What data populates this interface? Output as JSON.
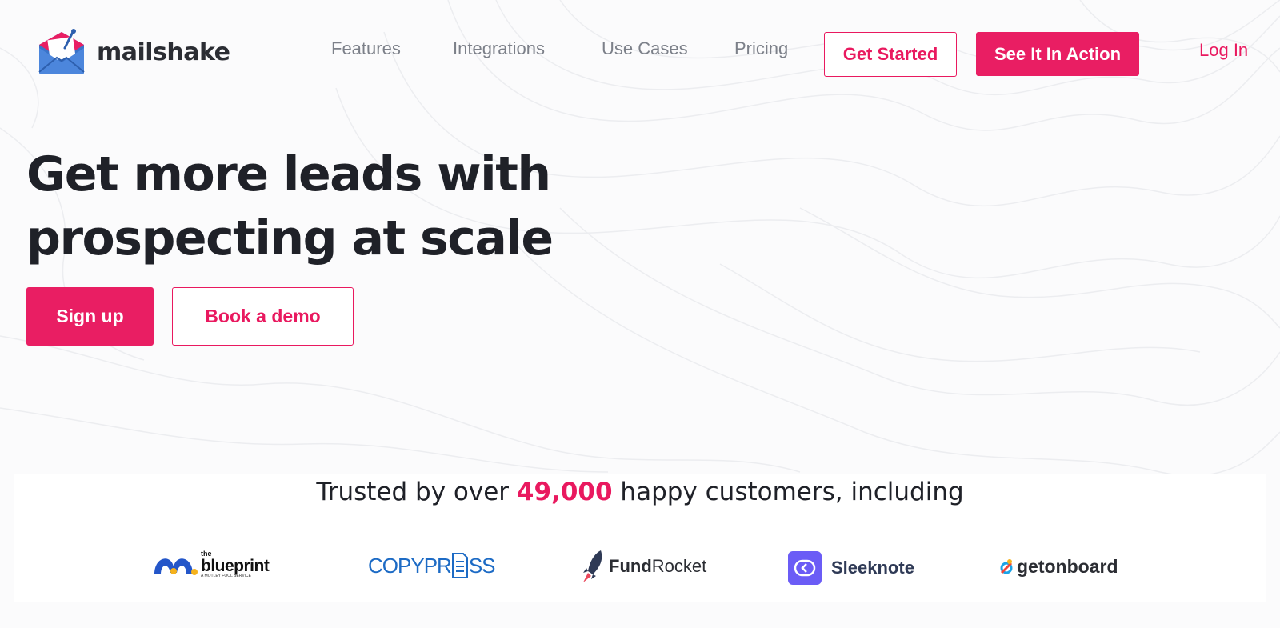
{
  "brand": {
    "name": "mailshake",
    "accent": "#e91e63",
    "text": "#1f2128"
  },
  "nav": {
    "links": [
      "Features",
      "Integrations",
      "Use Cases",
      "Pricing"
    ],
    "get_started": "Get Started",
    "see_action": "See It In Action",
    "login": "Log In"
  },
  "hero": {
    "title_line1": "Get more leads with",
    "title_line2": "prospecting at scale",
    "signup": "Sign up",
    "demo": "Book a demo"
  },
  "trusted": {
    "prefix": "Trusted by over",
    "count": "49,000",
    "suffix": "happy customers, including",
    "logos": [
      {
        "icon": "blueprint-icon",
        "name": "blueprint",
        "pre": "the",
        "sub": "A MOTLEY FOOL SERVICE"
      },
      {
        "icon": "copypress-icon",
        "name_a": "COPY",
        "name_b": "PR",
        "name_c": "SS"
      },
      {
        "icon": "rocket-icon",
        "name_a": "Fund",
        "name_b": "Rocket"
      },
      {
        "icon": "sleeknote-icon",
        "name": "Sleeknote"
      },
      {
        "icon": "getonboard-icon",
        "name": "getonboard"
      }
    ]
  }
}
